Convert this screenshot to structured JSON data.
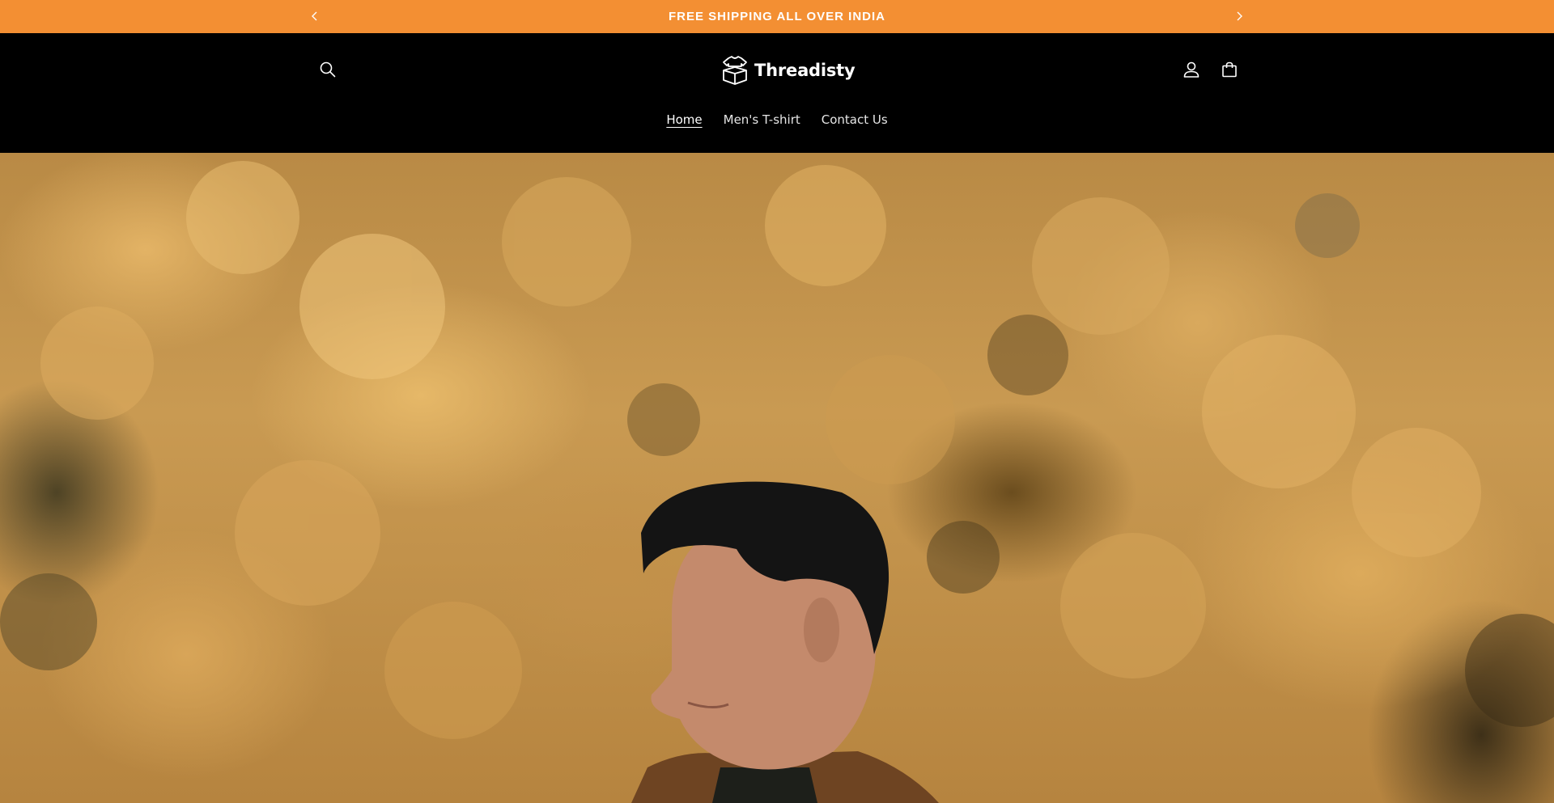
{
  "announcement": {
    "text": "FREE SHIPPING ALL OVER INDIA",
    "background": "#f38f33",
    "prev_icon": "chevron-left-icon",
    "next_icon": "chevron-right-icon"
  },
  "header": {
    "brand": "Threadisty",
    "logo_icon": "t-shirt-box-icon",
    "search_icon": "search-icon",
    "account_icon": "user-icon",
    "cart_icon": "cart-icon"
  },
  "nav": {
    "items": [
      {
        "label": "Home",
        "active": true
      },
      {
        "label": "Men's T-shirt",
        "active": false
      },
      {
        "label": "Contact Us",
        "active": false
      }
    ]
  },
  "hero": {
    "image": "man-in-front-of-autumn-foliage"
  }
}
